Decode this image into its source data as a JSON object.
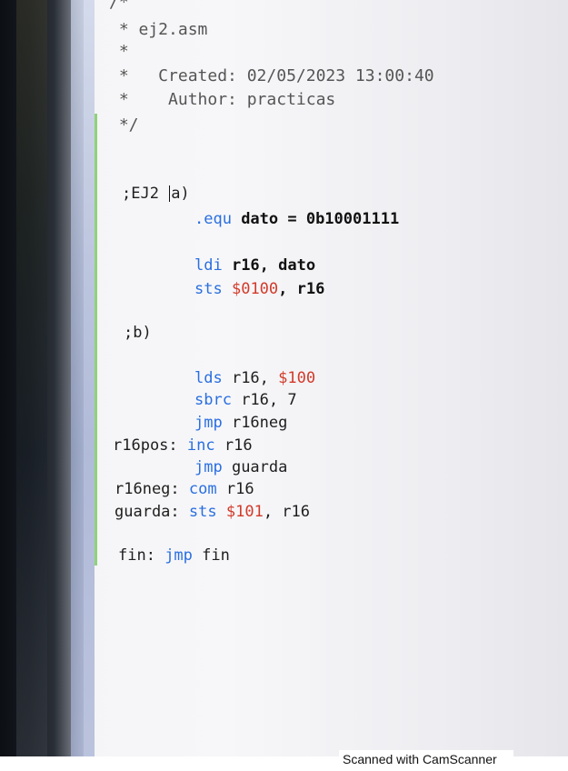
{
  "header_comment": {
    "open": "/*",
    "file_line": " * ej2.asm",
    "blank_line": " *",
    "created_line": " *   Created: 02/05/2023 13:00:40",
    "author_line": " *    Author: practicas",
    "close": " */"
  },
  "code": {
    "section_a_label": ";EJ2 ",
    "section_a_suffix": "a)",
    "equ_directive": ".equ",
    "equ_rest": " dato = 0b10001111",
    "ldi_op": "ldi",
    "ldi_args": " r16, dato",
    "sts_op": "sts",
    "sts_addr": "$0100",
    "sts_rest": ", r16",
    "section_b_label": ";b)",
    "lds_op": "lds",
    "lds_regs": " r16, ",
    "lds_addr": "$100",
    "sbrc_op": "sbrc",
    "sbrc_args": " r16, 7",
    "jmp1_op": "jmp",
    "jmp1_args": " r16neg",
    "label_r16pos": "r16pos: ",
    "inc_op": "inc",
    "inc_args": " r16",
    "jmp2_op": "jmp",
    "jmp2_args": " guarda",
    "label_r16neg": "r16neg: ",
    "com_op": "com",
    "com_args": " r16",
    "label_guarda": "guarda: ",
    "sts2_op": "sts",
    "sts2_addr": "$101",
    "sts2_rest": ", r16",
    "label_fin": "fin: ",
    "fin_op": "jmp",
    "fin_args": " fin"
  },
  "footer": {
    "watermark": "Scanned with CamScanner"
  },
  "colors": {
    "keyword": "#2a6fe0",
    "number": "#d23a2a",
    "gutter_change": "#8fd27a"
  }
}
